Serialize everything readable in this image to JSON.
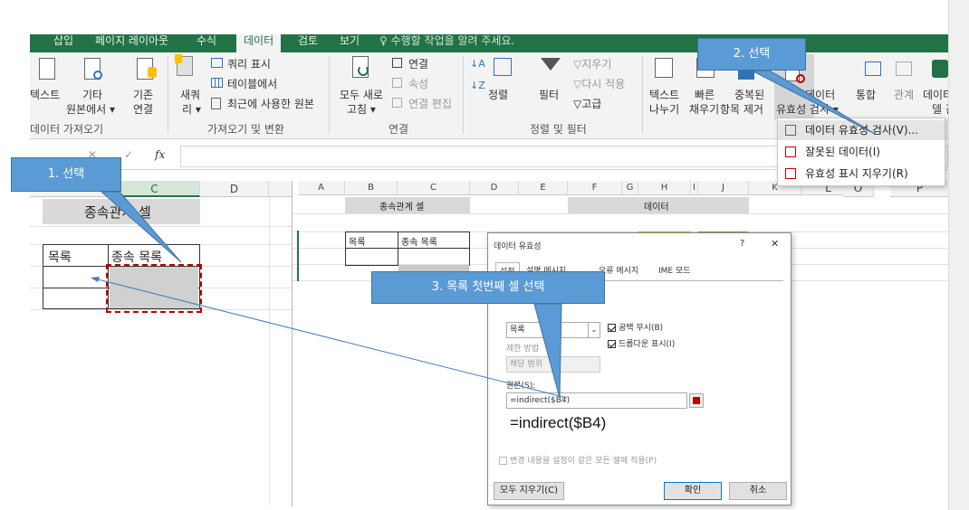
{
  "tabs": [
    "삽입",
    "페이지 레이아웃",
    "수식",
    "데이터",
    "검토",
    "보기",
    "♀ 수행할 작업을 알려 주세요."
  ],
  "ribbon": {
    "get_data": {
      "text_label": "텍스트",
      "other_label1": "기타",
      "other_label2": "원본에서 ▾",
      "existing_label1": "기존",
      "existing_label2": "연결",
      "group": "데이터 가져오기"
    },
    "transform": {
      "new_query1": "새쿼",
      "new_query2": "리 ▾",
      "show_query": "쿼리 표시",
      "from_table": "테이블에서",
      "recent": "최근에 사용한 원본",
      "group": "가져오기 및 변환"
    },
    "connections": {
      "refresh1": "모두 새로",
      "refresh2": "고침 ▾",
      "connections": "연결",
      "properties": "속성",
      "edit_links": "연결 편집",
      "group": "연결"
    },
    "sort_filter": {
      "sort": "정렬",
      "filter": "필터",
      "clear": "지우기",
      "reapply": "다시 적용",
      "advanced": "고급",
      "group": "정렬 및 필터"
    },
    "data_tools": {
      "text_to_col1": "텍스트",
      "text_to_col2": "나누기",
      "flash1": "빠른",
      "flash2": "채우기",
      "dup1": "중복된",
      "dup2": "항목 제거",
      "dv1": "데이터",
      "dv2": "유효성 검사 ▾",
      "consolidate": "통합",
      "relations": "관계",
      "model1": "데이터",
      "model2": "델 관"
    }
  },
  "formula_bar": {
    "fx": "fx",
    "x_sym": "✕",
    "check_sym": "✓"
  },
  "grid": {
    "columns": [
      "C",
      "D"
    ],
    "title_cell": "종속관계 셀",
    "header_list": "목록",
    "header_dependent": "종속 목록"
  },
  "embed": {
    "columns": [
      "A",
      "B",
      "C",
      "D",
      "E",
      "F",
      "G",
      "H",
      "I",
      "J",
      "K",
      "L",
      "O",
      "P"
    ],
    "title_cell": "종속관계 셀",
    "data_cell": "데이터",
    "header_list": "목록",
    "header_dependent": "종속 목록"
  },
  "dialog": {
    "title": "데이터 유효성",
    "help": "?",
    "close": "✕",
    "tabs": [
      "설정",
      "설명 메시지",
      "오류 메시지",
      "IME 모드"
    ],
    "allow_value": "목록",
    "ignore_blank": "공백 무시(B)",
    "dropdown": "드롭다운 표시(I)",
    "limit_label": "제한 방법",
    "data_value": "해당 범위",
    "source_label": "원본(S):",
    "source_value": "=indirect($B4)",
    "big_formula": "=indirect($B4)",
    "apply_all": "변경 내용을 설정이 같은 모든 셀에 적용(P)",
    "clear_all": "모두 지우기(C)",
    "ok": "확인",
    "cancel": "취소"
  },
  "dv_menu": {
    "items": [
      "데이터 유효성 검사(V)...",
      "잘못된 데이터(I)",
      "유효성 표시 지우기(R)"
    ]
  },
  "callouts": {
    "c1": "1. 선택",
    "c2": "2. 선택",
    "c3": "3. 목록 첫번째 셀 선택"
  },
  "colors": {
    "excel_green": "#217346",
    "callout_blue": "#5b9bd5",
    "selection_red": "#c00000"
  }
}
